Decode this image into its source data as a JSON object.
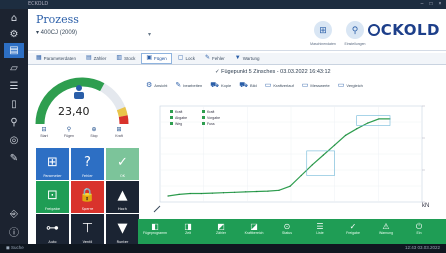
{
  "window": {
    "title": "ECKOLD"
  },
  "header": {
    "app_title": "Prozess",
    "app_subtitle": "▾ 400CJ (2009)",
    "circle_caption_1": "Maschinendaten",
    "circle_caption_2": "Einstellungen",
    "logo": "CKOLD"
  },
  "tabs": [
    {
      "icon": "▦",
      "label": "Parameterdaten"
    },
    {
      "icon": "▤",
      "label": "Zähler"
    },
    {
      "icon": "▥",
      "label": "Stock"
    },
    {
      "icon": "▣",
      "label": "Fügen"
    },
    {
      "icon": "▢",
      "label": "Lock"
    },
    {
      "icon": "✎",
      "label": "Fehler"
    },
    {
      "icon": "▼",
      "label": "Wartung"
    }
  ],
  "gauge": {
    "value": "23,40",
    "fill_fraction": 0.75,
    "colors": {
      "green": "#2e9e4f",
      "red": "#d9332c",
      "yellow": "#e9c44a"
    }
  },
  "mini_row": [
    {
      "icon": "⊟",
      "caption": "Start"
    },
    {
      "icon": "⚲",
      "caption": "Fügen"
    },
    {
      "icon": "⊕",
      "caption": "Stop"
    },
    {
      "icon": "⊞",
      "caption": "Kraft"
    }
  ],
  "tiles": [
    {
      "label": "Parameter",
      "color": "#2d6fc4",
      "icon": "⊞"
    },
    {
      "label": "Fehler",
      "color": "#2d6fc4",
      "icon": "?"
    },
    {
      "label": "OK",
      "color": "#7cc49a",
      "icon": "✓"
    },
    {
      "label": "Freigabe",
      "color": "#1f9d55",
      "icon": "⊡"
    },
    {
      "label": "Sperre",
      "color": "#d9332c",
      "icon": "🔒"
    },
    {
      "label": "Hoch",
      "color": "#1b2433",
      "icon": "▲"
    },
    {
      "label": "Auto",
      "color": "#1b2433",
      "icon": "⊶"
    },
    {
      "label": "Ventil",
      "color": "#1b2433",
      "icon": "⊤"
    },
    {
      "label": "Runter",
      "color": "#1b2433",
      "icon": "▼"
    }
  ],
  "chart": {
    "title": "✓ Fügepunkt 5 Zinsches - 03.03.2022 16:43:12",
    "toolbar": [
      {
        "icon": "⚙",
        "label": "Ansicht"
      },
      {
        "icon": "✎",
        "label": "bearbeiten"
      },
      {
        "icon": "⛟",
        "label": "Kopie"
      },
      {
        "icon": "⛟",
        "label": "Bild"
      },
      {
        "icon": "▭",
        "label": "Kraftverlauf"
      },
      {
        "icon": "▭",
        "label": "Messwerte"
      },
      {
        "icon": "▭",
        "label": "Vergleich"
      }
    ],
    "legend": [
      {
        "label": "Kraft",
        "color": "#2e9e4f"
      },
      {
        "label": "Abgabe",
        "color": "#2e9e4f"
      },
      {
        "label": "Weg",
        "color": "#2e9e4f"
      },
      {
        "label": "Kraft",
        "color": "#2e9e4f"
      },
      {
        "label": "Vorgabe",
        "color": "#2e9e4f"
      },
      {
        "label": "Fuss",
        "color": "#2e9e4f"
      }
    ],
    "right_unit": "kN"
  },
  "chart_data": {
    "type": "line",
    "title": "✓ Fügepunkt 5 Zinsches - 03.03.2022 16:43:12",
    "xlabel": "",
    "ylabel": "",
    "x": [
      0,
      1,
      2,
      3,
      4,
      5,
      6,
      7,
      8,
      9,
      10,
      11,
      12,
      13,
      14,
      15,
      16,
      17,
      18,
      19,
      20
    ],
    "series": [
      {
        "name": "Kraft",
        "values": [
          0.0,
          0.2,
          0.3,
          0.3,
          0.35,
          0.4,
          0.45,
          0.5,
          0.55,
          0.6,
          0.7,
          1.2,
          2.5,
          3.8,
          5.0,
          6.2,
          7.4,
          8.2,
          8.9,
          9.4,
          9.4
        ]
      }
    ],
    "ylim": [
      0,
      10
    ],
    "grid": true,
    "legend": "top-left"
  },
  "greenbar": [
    {
      "icon": "◧",
      "label": "Fügeprogramm"
    },
    {
      "icon": "◨",
      "label": "Zeit"
    },
    {
      "icon": "◩",
      "label": "Zähler"
    },
    {
      "icon": "◪",
      "label": "Kraftbereich"
    },
    {
      "icon": "⊙",
      "label": "Status"
    },
    {
      "icon": "☰",
      "label": "Liste"
    },
    {
      "icon": "✓",
      "label": "Freigabe"
    },
    {
      "icon": "⚠",
      "label": "Warnung"
    },
    {
      "icon": "⏻",
      "label": "Ein"
    }
  ],
  "taskbar": {
    "left": "◼ Suche",
    "right": "12:43  03.03.2022"
  }
}
